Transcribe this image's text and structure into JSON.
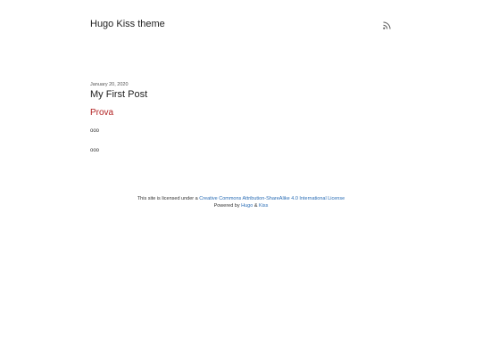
{
  "header": {
    "site_title": "Hugo Kiss theme",
    "rss_icon": "rss-icon"
  },
  "post": {
    "date": "January 20, 2020",
    "title": "My First Post",
    "heading": "Prova",
    "paragraphs": [
      "ooo",
      "ooo"
    ]
  },
  "footer": {
    "license_prefix": "This site is licensed under a ",
    "license_link": "Creative Commons Attribution-ShareAlike 4.0 International License",
    "powered_prefix": "Powered by ",
    "hugo_link": "Hugo",
    "ampersand": " & ",
    "kiss_link": "Kiss"
  },
  "colors": {
    "heading": "#b22222",
    "link": "#2a6db5",
    "text": "#222222"
  }
}
